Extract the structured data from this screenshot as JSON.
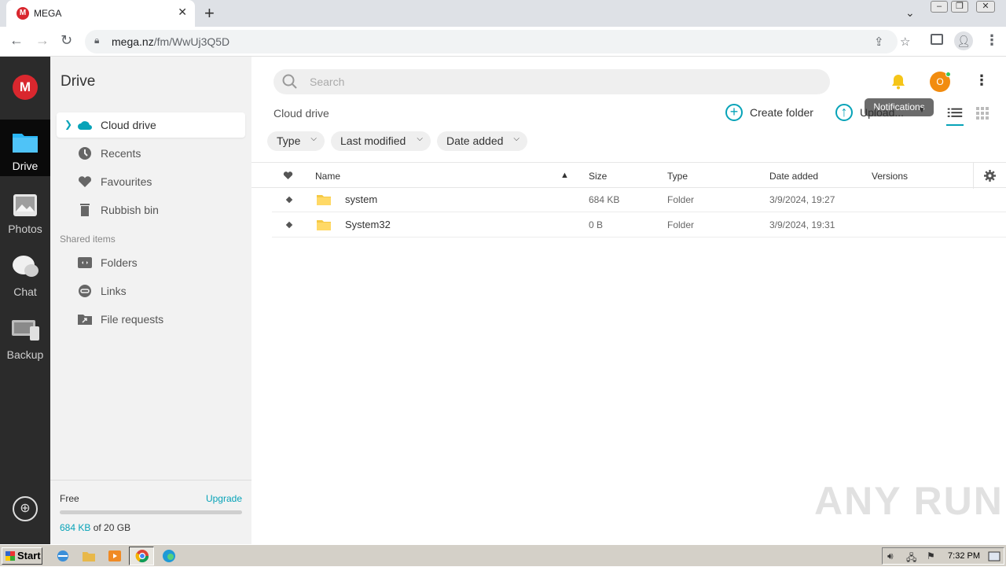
{
  "browser": {
    "tab_title": "MEGA",
    "tab_icon_letter": "M",
    "url_domain": "mega.nz",
    "url_path": "/fm/WwUj3Q5D"
  },
  "rail": {
    "logo_letter": "M",
    "items": [
      {
        "label": "Drive",
        "icon": "folder-icon",
        "active": true
      },
      {
        "label": "Photos",
        "icon": "photos-icon",
        "active": false
      },
      {
        "label": "Chat",
        "icon": "chat-icon",
        "active": false
      },
      {
        "label": "Backup",
        "icon": "backup-icon",
        "active": false
      }
    ]
  },
  "sidebar": {
    "title": "Drive",
    "items": [
      {
        "label": "Cloud drive",
        "icon": "cloud-icon",
        "selected": true
      },
      {
        "label": "Recents",
        "icon": "clock-icon"
      },
      {
        "label": "Favourites",
        "icon": "heart-icon"
      },
      {
        "label": "Rubbish bin",
        "icon": "trash-icon"
      }
    ],
    "shared_heading": "Shared items",
    "shared_items": [
      {
        "label": "Folders",
        "icon": "shared-folder-icon"
      },
      {
        "label": "Links",
        "icon": "link-icon"
      },
      {
        "label": "File requests",
        "icon": "file-request-icon"
      }
    ],
    "storage": {
      "plan": "Free",
      "upgrade_label": "Upgrade",
      "used": "684 KB",
      "of_label": "of 20 GB",
      "used_fraction": 3e-05
    }
  },
  "topbar": {
    "search_placeholder": "Search",
    "avatar_letter": "O",
    "tooltip": "Notifications"
  },
  "breadcrumb": "Cloud drive",
  "actions": {
    "create_folder": "Create folder",
    "upload": "Upload..."
  },
  "filters": [
    "Type",
    "Last modified",
    "Date added"
  ],
  "table": {
    "columns": [
      "Name",
      "Size",
      "Type",
      "Date added",
      "Versions"
    ],
    "rows": [
      {
        "name": "system",
        "size": "684 KB",
        "type": "Folder",
        "date_added": "3/9/2024, 19:27",
        "versions": ""
      },
      {
        "name": "System32",
        "size": "0 B",
        "type": "Folder",
        "date_added": "3/9/2024, 19:31",
        "versions": ""
      }
    ]
  },
  "watermark": "ANY RUN",
  "taskbar": {
    "start_label": "Start",
    "clock": "7:32 PM"
  },
  "colors": {
    "accent": "#07a3b8",
    "mega_red": "#d9272e",
    "rail_bg": "#2b2b2b",
    "avatar": "#f28c0f"
  }
}
